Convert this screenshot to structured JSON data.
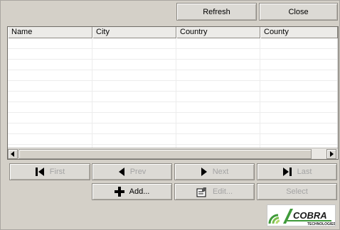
{
  "toolbar": {
    "refresh_label": "Refresh",
    "close_label": "Close"
  },
  "table": {
    "columns": [
      "Name",
      "City",
      "Country",
      "County"
    ],
    "rows": []
  },
  "navigation": {
    "first_label": "First",
    "prev_label": "Prev",
    "next_label": "Next",
    "last_label": "Last"
  },
  "actions": {
    "add_label": "Add...",
    "edit_label": "Edit...",
    "select_label": "Select"
  },
  "logo": {
    "text": "COBRA",
    "subtext": "TECHNOLOGIES"
  },
  "icons": {
    "first": "skip-first-icon",
    "prev": "arrow-left-icon",
    "next": "arrow-right-icon",
    "last": "skip-last-icon",
    "add": "plus-icon",
    "edit": "edit-form-icon"
  },
  "colors": {
    "background": "#d4d0c8",
    "logo_green": "#3f9a3a",
    "logo_text": "#1a1a1a"
  }
}
